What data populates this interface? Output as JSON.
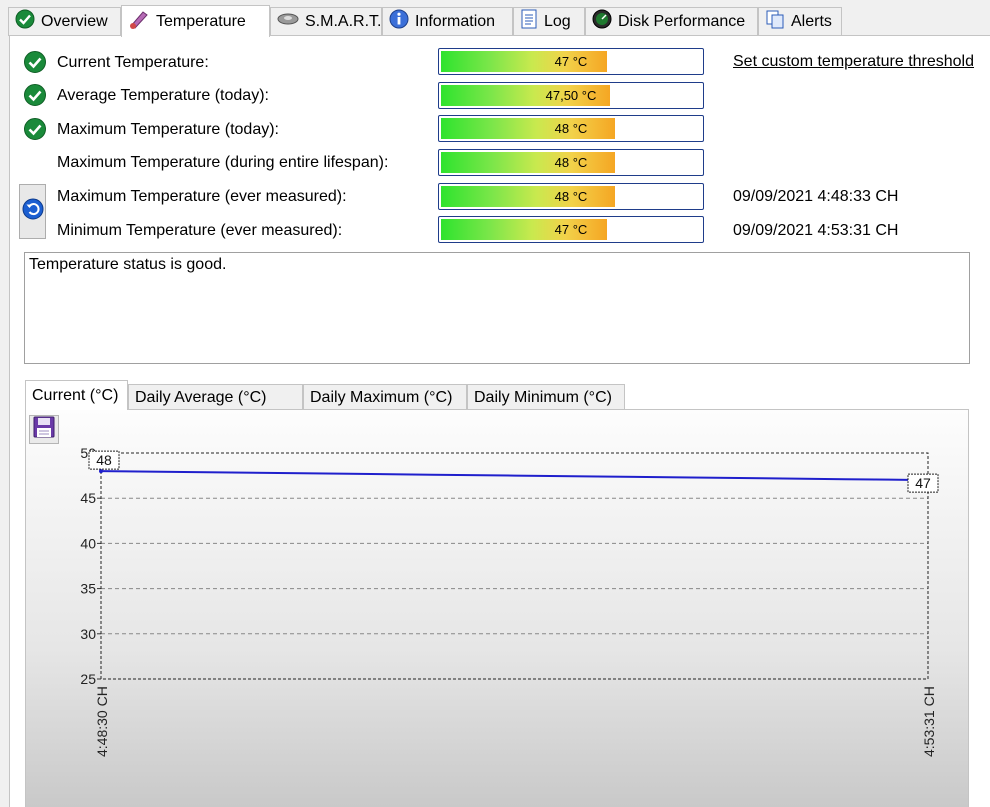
{
  "tabs": [
    {
      "label": "Overview",
      "icon": "check-circle-icon"
    },
    {
      "label": "Temperature",
      "icon": "thermometer-icon"
    },
    {
      "label": "S.M.A.R.T.",
      "icon": "disk-icon"
    },
    {
      "label": "Information",
      "icon": "info-icon"
    },
    {
      "label": "Log",
      "icon": "document-icon"
    },
    {
      "label": "Disk Performance",
      "icon": "gauge-icon"
    },
    {
      "label": "Alerts",
      "icon": "copy-icon"
    }
  ],
  "temps": [
    {
      "label": "Current Temperature:",
      "value": "47 °C",
      "level": 0.63,
      "ok": true
    },
    {
      "label": "Average Temperature (today):",
      "value": "47,50 °C",
      "level": 0.64,
      "ok": true
    },
    {
      "label": "Maximum Temperature (today):",
      "value": "48 °C",
      "level": 0.66,
      "ok": true
    },
    {
      "label": "Maximum Temperature (during entire lifespan):",
      "value": "48 °C",
      "level": 0.66,
      "ok": false
    },
    {
      "label": "Maximum Temperature (ever measured):",
      "value": "48 °C",
      "level": 0.66,
      "ok": false,
      "date": "09/09/2021 4:48:33 CH"
    },
    {
      "label": "Minimum Temperature (ever measured):",
      "value": "47 °C",
      "level": 0.63,
      "ok": false,
      "date": "09/09/2021 4:53:31 CH"
    }
  ],
  "threshold_link": "Set custom temperature threshold",
  "status_text": "Temperature status is good.",
  "subtabs": [
    "Current (°C)",
    "Daily Average (°C)",
    "Daily Maximum (°C)",
    "Daily Minimum (°C)"
  ],
  "chart_data": {
    "type": "line",
    "x": [
      "4:48:30 CH",
      "4:53:31 CH"
    ],
    "series": [
      {
        "values": [
          48,
          47.9,
          47.8,
          47.7,
          47.6,
          47.5,
          47.4,
          47.3,
          47.2,
          47.1,
          47
        ]
      }
    ],
    "ylim": [
      25,
      50
    ],
    "yticks": [
      "25",
      "30",
      "35",
      "40",
      "45",
      "50"
    ],
    "point_labels": [
      "48",
      "47"
    ],
    "line_color": "#1f1fcc",
    "grid": true
  }
}
